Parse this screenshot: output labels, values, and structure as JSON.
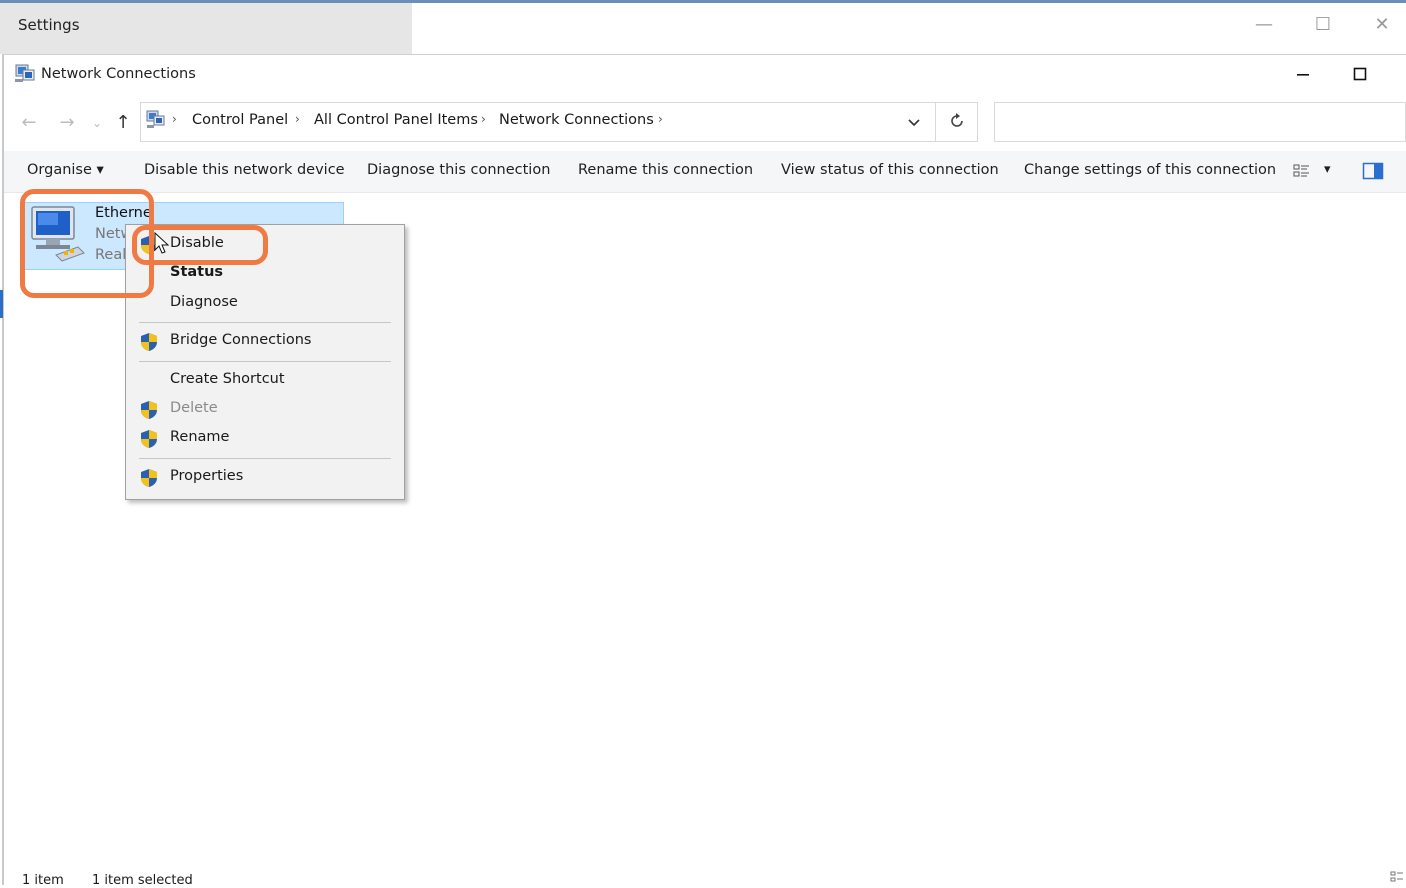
{
  "settings_window": {
    "title": "Settings",
    "controls": {
      "minimize": "—",
      "maximize": "☐",
      "close": "✕"
    }
  },
  "window": {
    "title": "Network Connections",
    "controls": {
      "minimize": "—",
      "maximize": "☐"
    }
  },
  "address_bar": {
    "breadcrumbs": [
      "Control Panel",
      "All Control Panel Items",
      "Network Connections"
    ],
    "separator": "›",
    "dropdown_icon": "chevron-down-icon",
    "refresh_icon": "refresh-icon",
    "search_placeholder": ""
  },
  "nav": {
    "back": "←",
    "forward": "→",
    "recent": "⌄",
    "up": "↑"
  },
  "command_bar": {
    "organise": "Organise ▾",
    "items": [
      "Disable this network device",
      "Diagnose this connection",
      "Rename this connection",
      "View status of this connection",
      "Change settings of this connection"
    ],
    "view_menu_caret": "▾"
  },
  "connection_item": {
    "name": "Etherne",
    "line2": "Netw",
    "line3": "Real"
  },
  "context_menu": {
    "items": [
      {
        "label": "Disable",
        "shield": true,
        "bold": false,
        "disabled": false
      },
      {
        "label": "Status",
        "shield": false,
        "bold": true,
        "disabled": false
      },
      {
        "label": "Diagnose",
        "shield": false,
        "bold": false,
        "disabled": false
      },
      {
        "label": "Bridge Connections",
        "shield": true,
        "bold": false,
        "disabled": false
      },
      {
        "label": "Create Shortcut",
        "shield": false,
        "bold": false,
        "disabled": false
      },
      {
        "label": "Delete",
        "shield": true,
        "bold": false,
        "disabled": true
      },
      {
        "label": "Rename",
        "shield": true,
        "bold": false,
        "disabled": false
      },
      {
        "label": "Properties",
        "shield": true,
        "bold": false,
        "disabled": false
      }
    ]
  },
  "status_bar": {
    "item_count": "1 item",
    "selected": "1 item selected"
  },
  "colors": {
    "annotation": "#f07a44",
    "selection_bg": "#cce8ff",
    "shield_blue": "#2b5fb0",
    "shield_yellow": "#f2c21b"
  }
}
